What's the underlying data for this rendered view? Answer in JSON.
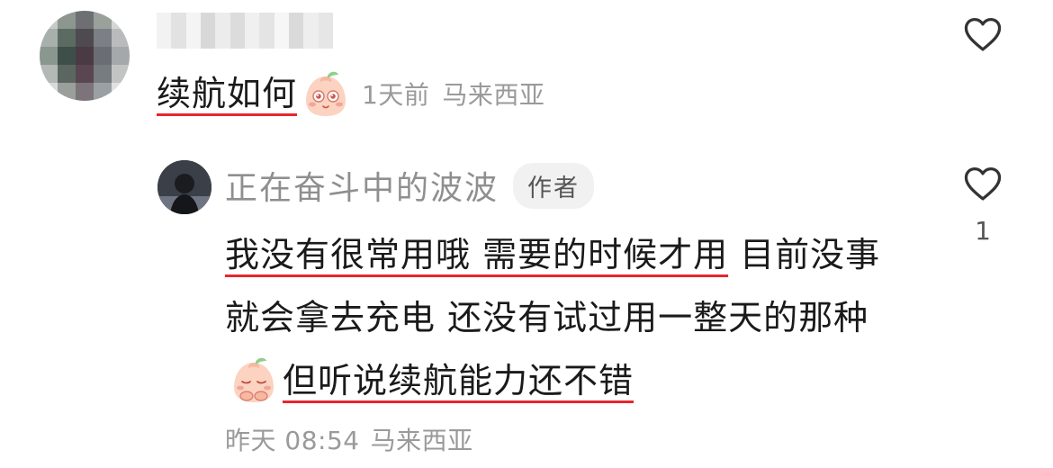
{
  "comment": {
    "text": "续航如何",
    "time": "1天前",
    "location": "马来西亚",
    "emoji_icon": "peach-emoji-sparkle-eyes-icon"
  },
  "reply": {
    "author": "正在奋斗中的波波",
    "author_badge": "作者",
    "segment1": "我没有很常用哦 需要的时候才用",
    "segment2": " 目前没事就会拿去充电 还没有试过用一整天的那种",
    "segment3": "但听说续航能力还不错",
    "emoji_icon": "peach-emoji-shy-hands-icon",
    "time": "昨天 08:54",
    "location": "马来西亚",
    "like_count": "1"
  },
  "colors": {
    "underline": "#e8262e",
    "meta_text": "#9a9a9a",
    "name_text": "#8f8f8f",
    "badge_bg": "#f1f1f1"
  },
  "icons": {
    "like": "heart-outline-icon"
  }
}
